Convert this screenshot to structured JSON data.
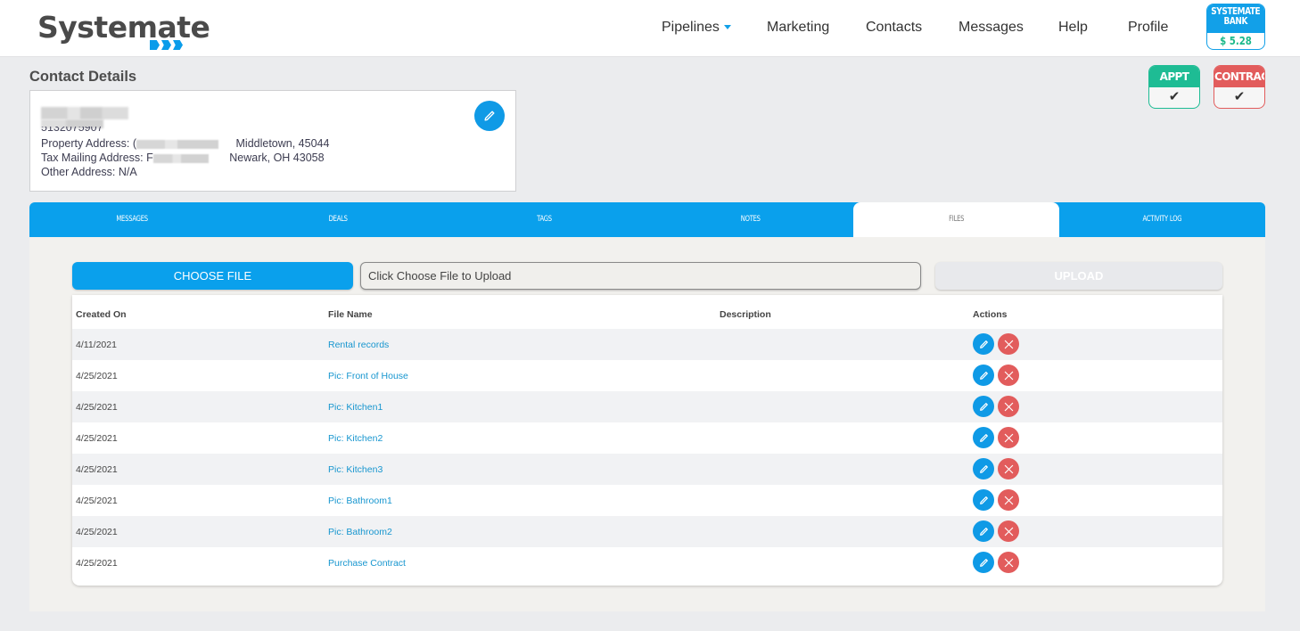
{
  "header": {
    "logo_text": "Systemate",
    "nav": [
      {
        "label": "Pipelines",
        "has_dropdown": true
      },
      {
        "label": "Marketing"
      },
      {
        "label": "Contacts"
      },
      {
        "label": "Messages"
      },
      {
        "label": "Help"
      },
      {
        "label": "Profile"
      }
    ],
    "bank": {
      "line1": "SYSTEMATE",
      "line2": "BANK",
      "amount": "$ 5.28"
    }
  },
  "status_badges": {
    "appt": {
      "label": "APPT",
      "check": "✔",
      "color": "#1ebc94"
    },
    "contract": {
      "label": "CONTRACT",
      "check": "✔",
      "color": "#e25c5c"
    }
  },
  "contact": {
    "section_title": "Contact Details",
    "phone_partial": "5132075907",
    "property_label": "Property Address:",
    "property_prefix": "(",
    "property_city": "Middletown, 45044",
    "tax_label": "Tax Mailing Address:",
    "tax_prefix": "F",
    "tax_city": "Newark, OH 43058",
    "other_label": "Other Address:",
    "other_value": "N/A"
  },
  "tabs": [
    {
      "label": "MESSAGES",
      "active": false
    },
    {
      "label": "DEALS",
      "active": false
    },
    {
      "label": "TAGS",
      "active": false
    },
    {
      "label": "NOTES",
      "active": false
    },
    {
      "label": "FILES",
      "active": true
    },
    {
      "label": "ACTIVITY LOG",
      "active": false
    }
  ],
  "files": {
    "choose_label": "CHOOSE FILE",
    "file_field_text": "Click Choose File to Upload",
    "upload_label": "UPLOAD",
    "columns": [
      "Created On",
      "File Name",
      "Description",
      "Actions"
    ],
    "rows": [
      {
        "created": "4/11/2021",
        "name": "Rental records",
        "description": ""
      },
      {
        "created": "4/25/2021",
        "name": "Pic: Front of House",
        "description": ""
      },
      {
        "created": "4/25/2021",
        "name": "Pic: Kitchen1",
        "description": ""
      },
      {
        "created": "4/25/2021",
        "name": "Pic: Kitchen2",
        "description": ""
      },
      {
        "created": "4/25/2021",
        "name": "Pic: Kitchen3",
        "description": ""
      },
      {
        "created": "4/25/2021",
        "name": "Pic: Bathroom1",
        "description": ""
      },
      {
        "created": "4/25/2021",
        "name": "Pic: Bathroom2",
        "description": ""
      },
      {
        "created": "4/25/2021",
        "name": "Purchase Contract",
        "description": ""
      }
    ]
  },
  "colors": {
    "primary": "#0aa0ec",
    "danger": "#e25c5c",
    "success": "#1ebc94",
    "link": "#1796cf"
  }
}
